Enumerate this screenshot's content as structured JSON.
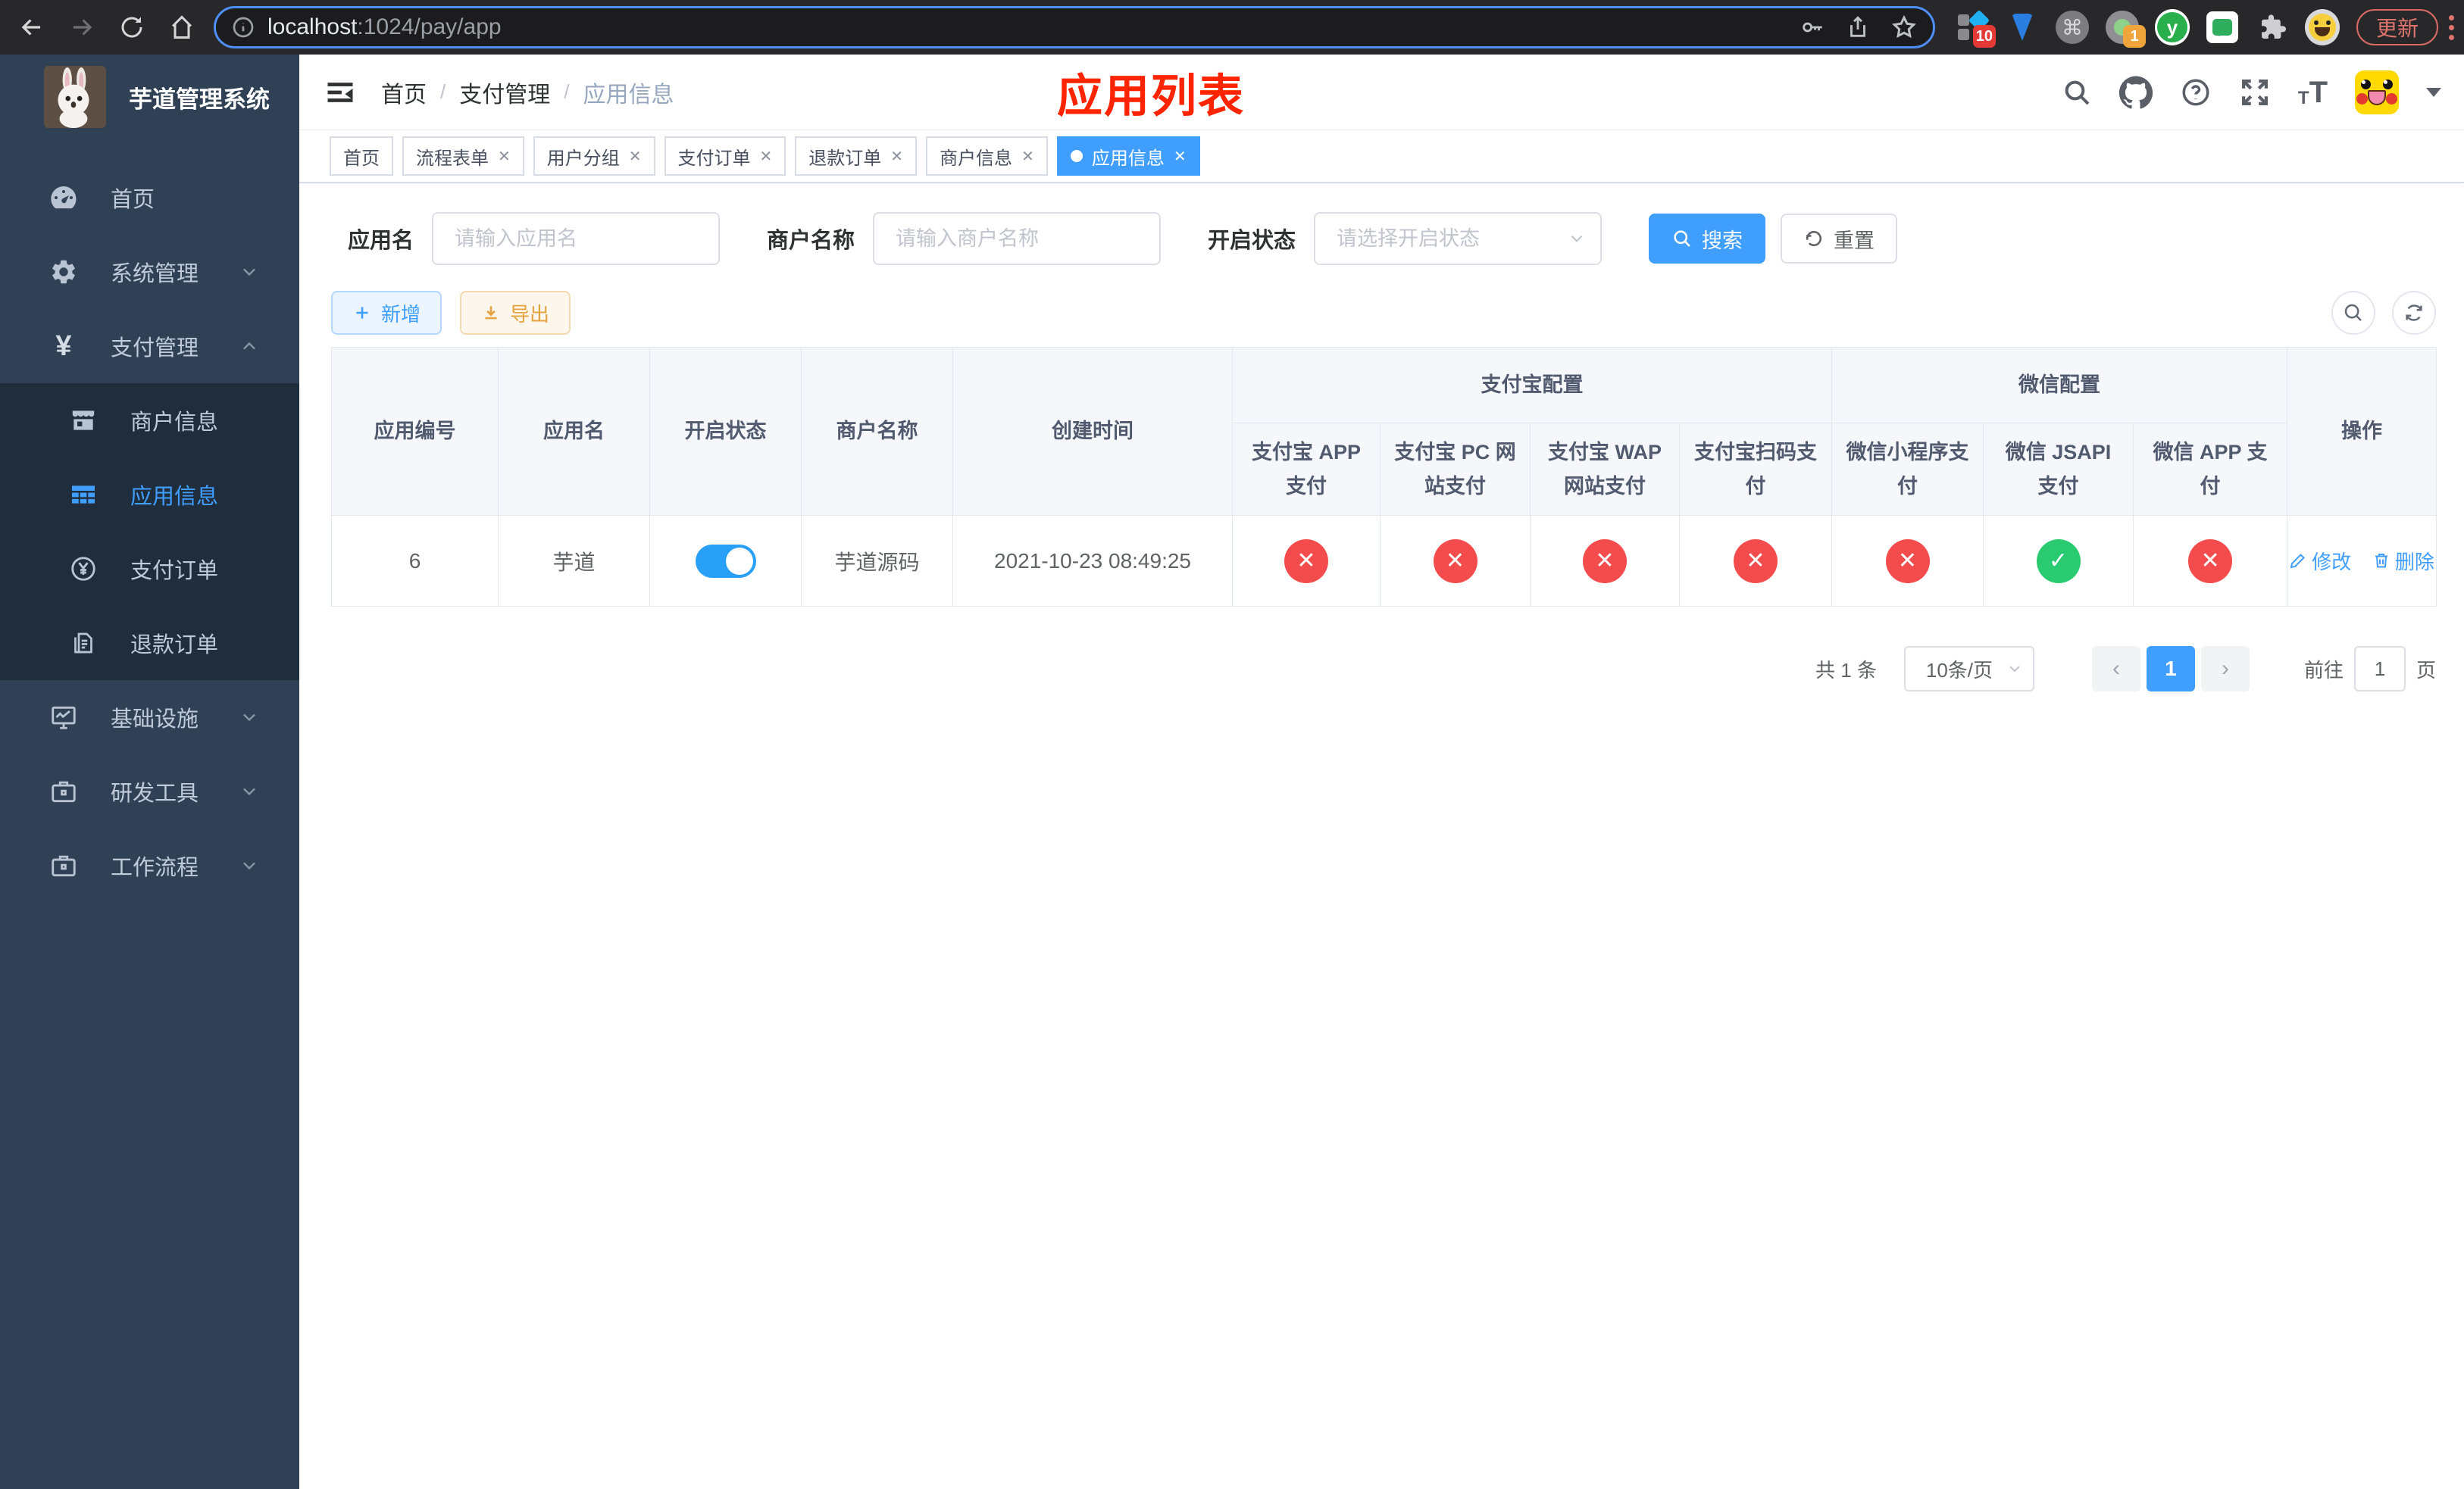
{
  "browser": {
    "url": {
      "host": "localhost",
      "path": ":1024/pay/app"
    },
    "update_button": "更新",
    "ext_badges": {
      "grid": "10",
      "record": "1"
    },
    "ext_y_letter": "y",
    "cmd_glyph": "⌘"
  },
  "sidebar": {
    "title": "芋道管理系统",
    "items": {
      "home": "首页",
      "system": "系统管理",
      "pay": "支付管理",
      "merchant": "商户信息",
      "app": "应用信息",
      "order": "支付订单",
      "refund": "退款订单",
      "infra": "基础设施",
      "dev": "研发工具",
      "workflow": "工作流程"
    }
  },
  "navbar": {
    "breadcrumb": [
      "首页",
      "支付管理",
      "应用信息"
    ],
    "separator": "/",
    "overlay_title": "应用列表"
  },
  "tabs": [
    {
      "label": "首页"
    },
    {
      "label": "流程表单"
    },
    {
      "label": "用户分组"
    },
    {
      "label": "支付订单"
    },
    {
      "label": "退款订单"
    },
    {
      "label": "商户信息"
    },
    {
      "label": "应用信息"
    }
  ],
  "filters": {
    "app_name_label": "应用名",
    "app_name_placeholder": "请输入应用名",
    "merchant_label": "商户名称",
    "merchant_placeholder": "请输入商户名称",
    "status_label": "开启状态",
    "status_placeholder": "请选择开启状态",
    "search": "搜索",
    "reset": "重置"
  },
  "toolbar": {
    "add": "新增",
    "export": "导出"
  },
  "table": {
    "headers": {
      "app_id": "应用编号",
      "app_name": "应用名",
      "status": "开启状态",
      "merchant": "商户名称",
      "created": "创建时间",
      "alipay_group": "支付宝配置",
      "wechat_group": "微信配置",
      "actions": "操作",
      "alipay_app": "支付宝 APP 支付",
      "alipay_pc": "支付宝 PC 网站支付",
      "alipay_wap": "支付宝 WAP 网站支付",
      "alipay_qr": "支付宝扫码支付",
      "wx_mini": "微信小程序支付",
      "wx_jsapi": "微信 JSAPI 支付",
      "wx_app": "微信 APP 支付"
    },
    "row": {
      "id": "6",
      "name": "芋道",
      "enabled": true,
      "merchant": "芋道源码",
      "created": "2021-10-23 08:49:25",
      "channels": {
        "alipay_app": false,
        "alipay_pc": false,
        "alipay_wap": false,
        "alipay_qr": false,
        "wx_mini": false,
        "wx_jsapi": true,
        "wx_app": false
      },
      "edit": "修改",
      "delete": "删除"
    }
  },
  "pagination": {
    "total": "共 1 条",
    "page_size": "10条/页",
    "page": "1",
    "goto": "前往",
    "goto_value": "1",
    "unit": "页"
  },
  "colors": {
    "primary": "#409eff",
    "success": "#2aca71",
    "danger": "#f44c4c",
    "warning": "#e6a23c",
    "sidebar_bg": "#304156",
    "submenu_bg": "#1f2d3d",
    "annotation_red": "#ff2400"
  }
}
